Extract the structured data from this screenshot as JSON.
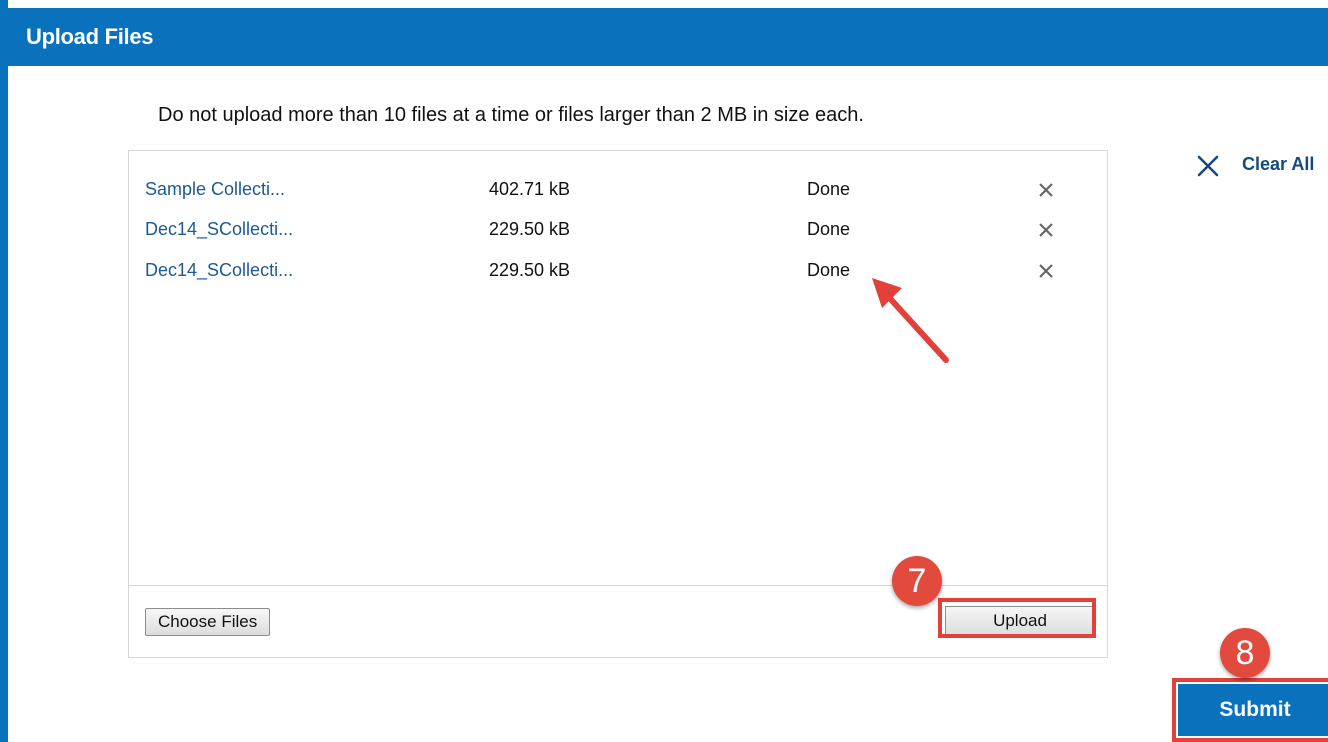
{
  "dialog": {
    "title": "Upload Files"
  },
  "notice": "Do not upload more than 10 files at a time or files larger than 2 MB in size each.",
  "clear_all": {
    "label": "Clear All",
    "icon": "close-icon"
  },
  "files": [
    {
      "name": "Sample Collecti...",
      "size": "402.71 kB",
      "status": "Done",
      "remove_icon": "remove-icon"
    },
    {
      "name": "Dec14_SCollecti...",
      "size": "229.50 kB",
      "status": "Done",
      "remove_icon": "remove-icon"
    },
    {
      "name": "Dec14_SCollecti...",
      "size": "229.50 kB",
      "status": "Done",
      "remove_icon": "remove-icon"
    }
  ],
  "buttons": {
    "choose_files": "Choose Files",
    "upload": "Upload",
    "submit": "Submit"
  },
  "annotations": {
    "step_upload": "7",
    "step_submit": "8",
    "arrow_target": "file status Done",
    "accent_color": "#e1403b"
  },
  "colors": {
    "brand_blue": "#0a72bd",
    "link_blue": "#1b5a93"
  }
}
